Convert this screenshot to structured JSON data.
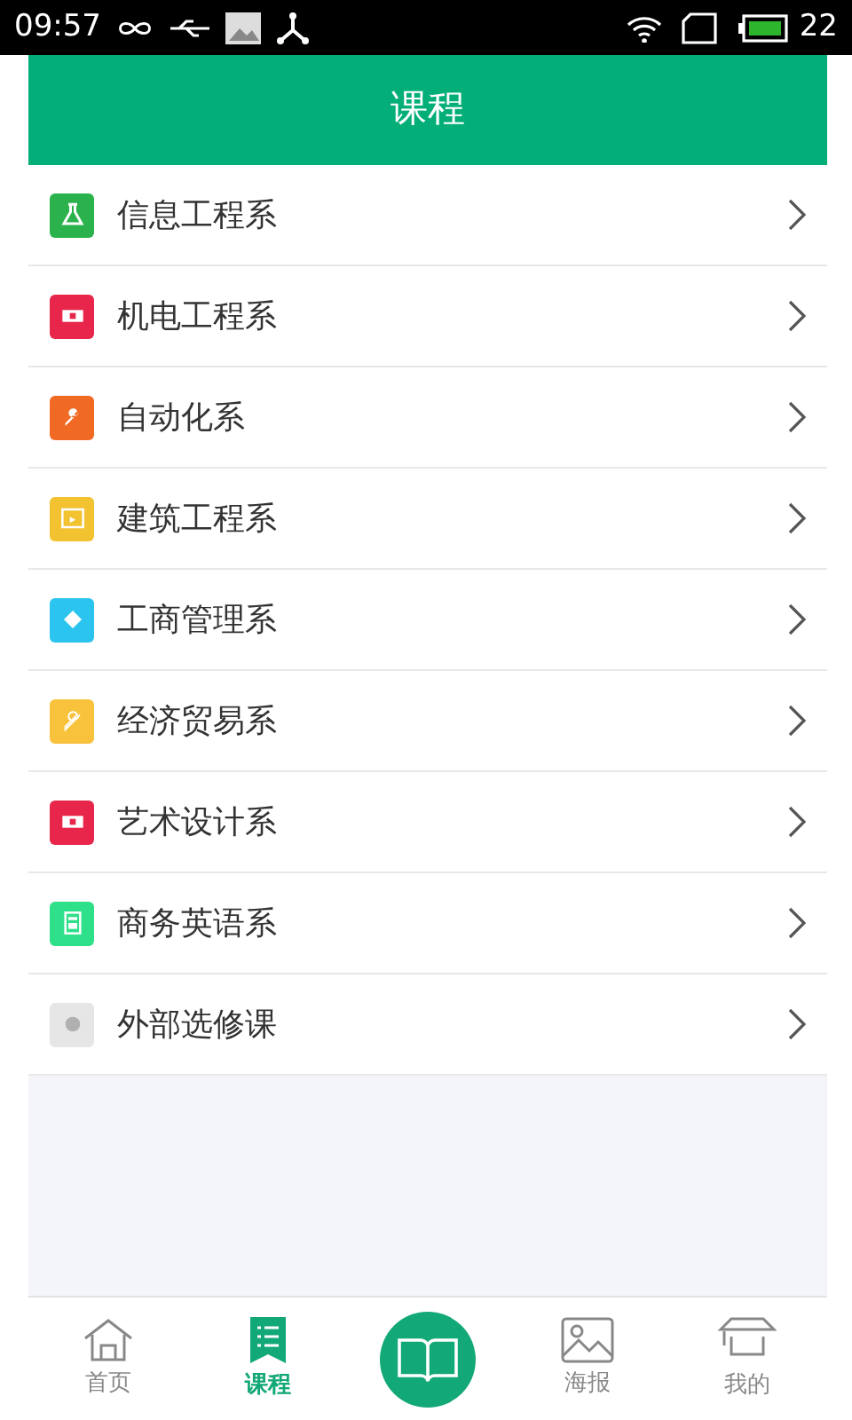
{
  "status_bar": {
    "time": "09:57",
    "battery": "22"
  },
  "header": {
    "title": "课程"
  },
  "departments": [
    {
      "label": "信息工程系",
      "color": "#2bb24c"
    },
    {
      "label": "机电工程系",
      "color": "#e8264b"
    },
    {
      "label": "自动化系",
      "color": "#f06a24"
    },
    {
      "label": "建筑工程系",
      "color": "#f2c230"
    },
    {
      "label": "工商管理系",
      "color": "#2bc4ee"
    },
    {
      "label": "经济贸易系",
      "color": "#f9c23c"
    },
    {
      "label": "艺术设计系",
      "color": "#e8264b"
    },
    {
      "label": "商务英语系",
      "color": "#2fe08a"
    },
    {
      "label": "外部选修课",
      "color": "#e6e6e6"
    }
  ],
  "tab_bar": [
    {
      "kind": "tab",
      "label": "首页",
      "selected": false
    },
    {
      "kind": "tab",
      "label": "课程",
      "selected": true
    },
    {
      "kind": "center",
      "selected": false
    },
    {
      "kind": "tab",
      "label": "海报",
      "selected": false
    },
    {
      "kind": "tab",
      "label": "我的",
      "selected": false
    }
  ]
}
